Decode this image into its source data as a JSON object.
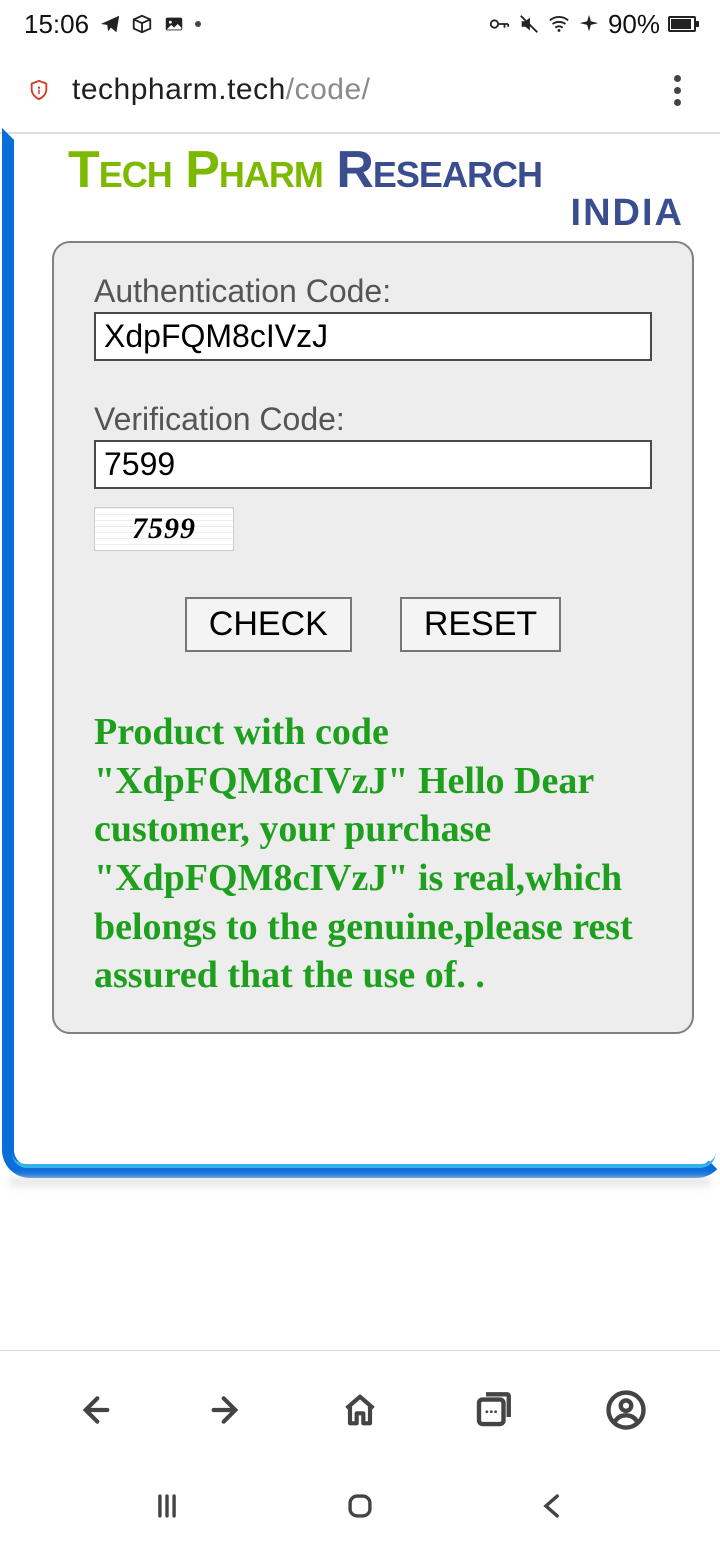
{
  "status": {
    "time": "15:06",
    "battery_pct": "90%"
  },
  "browser": {
    "url_domain": "techpharm.tech",
    "url_path": "/code/"
  },
  "logo": {
    "tech": "Tech",
    "pharm": "Pharm",
    "research": "Research",
    "india": "INDIA"
  },
  "form": {
    "auth_label": "Authentication Code:",
    "auth_value": "XdpFQM8cIVzJ",
    "verif_label": "Verification Code:",
    "verif_value": "7599",
    "captcha_text": "7599",
    "check_label": "CHECK",
    "reset_label": "RESET"
  },
  "result": {
    "message": "Product with code \"XdpFQM8cIVzJ\" Hello Dear customer, your purchase \"XdpFQM8cIVzJ\" is real,which belongs to the genuine,please rest assured that the use of. ."
  }
}
